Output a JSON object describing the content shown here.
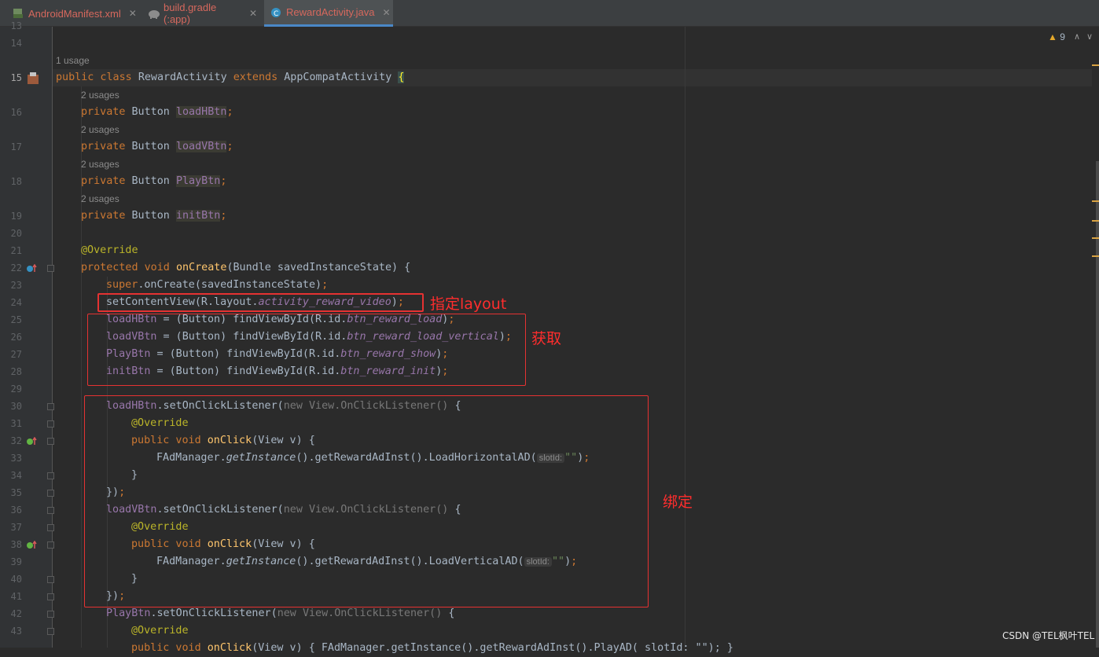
{
  "tabs": [
    {
      "label": "AndroidManifest.xml",
      "icon": "xml-file-icon"
    },
    {
      "label": "build.gradle (:app)",
      "icon": "gradle-elephant-icon"
    },
    {
      "label": "RewardActivity.java",
      "icon": "java-class-icon",
      "active": true
    }
  ],
  "warnings": {
    "count": "9"
  },
  "gutter": {
    "lines": [
      "13",
      "14",
      "15",
      "16",
      "17",
      "18",
      "19",
      "20",
      "21",
      "22",
      "23",
      "24",
      "25",
      "26",
      "27",
      "28",
      "29",
      "30",
      "31",
      "32",
      "33",
      "34",
      "35",
      "36",
      "37",
      "38",
      "39",
      "40",
      "41",
      "42",
      "43"
    ]
  },
  "usages": {
    "class": "1 usage",
    "field": "2 usages"
  },
  "code": {
    "l15": {
      "a": "public class ",
      "b": "RewardActivity ",
      "c": "extends ",
      "d": "AppCompatActivity ",
      "e": "{"
    },
    "l16": {
      "a": "private ",
      "b": "Button ",
      "c": "loadHBtn",
      "d": ";"
    },
    "l17": {
      "a": "private ",
      "b": "Button ",
      "c": "loadVBtn",
      "d": ";"
    },
    "l18": {
      "a": "private ",
      "b": "Button ",
      "c": "PlayBtn",
      "d": ";"
    },
    "l19": {
      "a": "private ",
      "b": "Button ",
      "c": "initBtn",
      "d": ";"
    },
    "l21": "@Override",
    "l22": {
      "a": "protected void ",
      "b": "onCreate",
      "c": "(Bundle savedInstanceState) {"
    },
    "l23": {
      "a": "super",
      "b": ".onCreate(savedInstanceState)",
      "c": ";"
    },
    "l24": {
      "a": "setContentView(R.layout.",
      "b": "activity_reward_video",
      "c": ")",
      "d": ";"
    },
    "l25": {
      "a": "loadHBtn",
      "b": " = (Button) findViewById(R.id.",
      "c": "btn_reward_load",
      "d": ")",
      "e": ";"
    },
    "l26": {
      "a": "loadVBtn",
      "b": " = (Button) findViewById(R.id.",
      "c": "btn_reward_load_vertical",
      "d": ")",
      "e": ";"
    },
    "l27": {
      "a": "PlayBtn",
      "b": " = (Button) findViewById(R.id.",
      "c": "btn_reward_show",
      "d": ")",
      "e": ";"
    },
    "l28": {
      "a": "initBtn",
      "b": " = (Button) findViewById(R.id.",
      "c": "btn_reward_init",
      "d": ")",
      "e": ";"
    },
    "l30": {
      "a": "loadHBtn",
      "b": ".setOnClickListener(",
      "c": "new ",
      "d": "View.OnClickListener() ",
      "e": "{"
    },
    "l31": "@Override",
    "l32": {
      "a": "public void ",
      "b": "onClick",
      "c": "(View v) {"
    },
    "l33": {
      "a": "FAdManager.",
      "b": "getInstance",
      "c": "().getRewardAdInst().LoadHorizontalAD(",
      "hint": "slotId:",
      "d": "\"\"",
      "e": ")",
      "f": ";"
    },
    "l34": "}",
    "l35": {
      "a": "})",
      "b": ";"
    },
    "l36": {
      "a": "loadVBtn",
      "b": ".setOnClickListener(",
      "c": "new ",
      "d": "View.OnClickListener() ",
      "e": "{"
    },
    "l37": "@Override",
    "l38": {
      "a": "public void ",
      "b": "onClick",
      "c": "(View v) {"
    },
    "l39": {
      "a": "FAdManager.",
      "b": "getInstance",
      "c": "().getRewardAdInst().LoadVerticalAD(",
      "hint": "slotId:",
      "d": "\"\"",
      "e": ")",
      "f": ";"
    },
    "l40": "}",
    "l41": {
      "a": "})",
      "b": ";"
    },
    "l42": {
      "a": "PlayBtn",
      "b": ".setOnClickListener(",
      "c": "new ",
      "d": "View.OnClickListener() ",
      "e": "{"
    },
    "l43": "@Override",
    "l44": {
      "a": "public void ",
      "b": "onClick",
      "c": "(View v) { FAdManager.getInstance().getRewardAdInst().PlayAD( slotId: \"\"); }"
    }
  },
  "annotations": {
    "layout_note": "指定layout",
    "get_note": "获取",
    "bind_note": "绑定"
  },
  "watermark": "CSDN @TEL枫叶TEL"
}
